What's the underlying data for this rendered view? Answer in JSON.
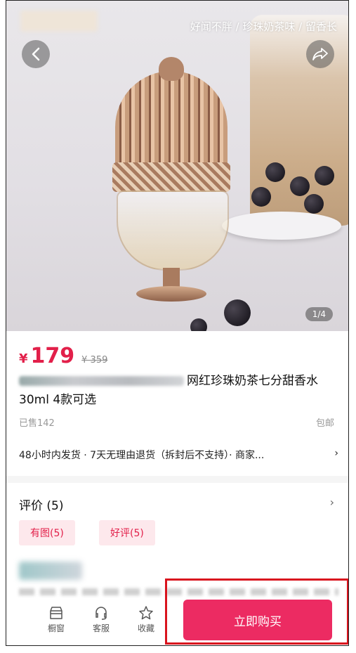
{
  "hero": {
    "tagline": "好闻不胖 / 珍珠奶茶味 / 留香长",
    "page_indicator": "1/4"
  },
  "product": {
    "currency": "¥",
    "price": "179",
    "original_price": "¥ 359",
    "title": "网红珍珠奶茶七分甜香水30ml 4款可选",
    "sold": "已售142",
    "shipping": "包邮",
    "service": "48小时内发货 · 7天无理由退货（拆封后不支持）· 商家..."
  },
  "reviews": {
    "header": "评价 (5)",
    "tags": [
      "有图(5)",
      "好评(5)"
    ]
  },
  "bottom_nav": {
    "items": [
      {
        "label": "橱窗",
        "icon": "storefront-icon"
      },
      {
        "label": "客服",
        "icon": "headset-icon"
      },
      {
        "label": "收藏",
        "icon": "star-icon"
      }
    ],
    "buy_label": "立即购买"
  },
  "colors": {
    "accent": "#e2204a",
    "buy_button": "#ec2b62",
    "highlight": "#d9141e"
  }
}
